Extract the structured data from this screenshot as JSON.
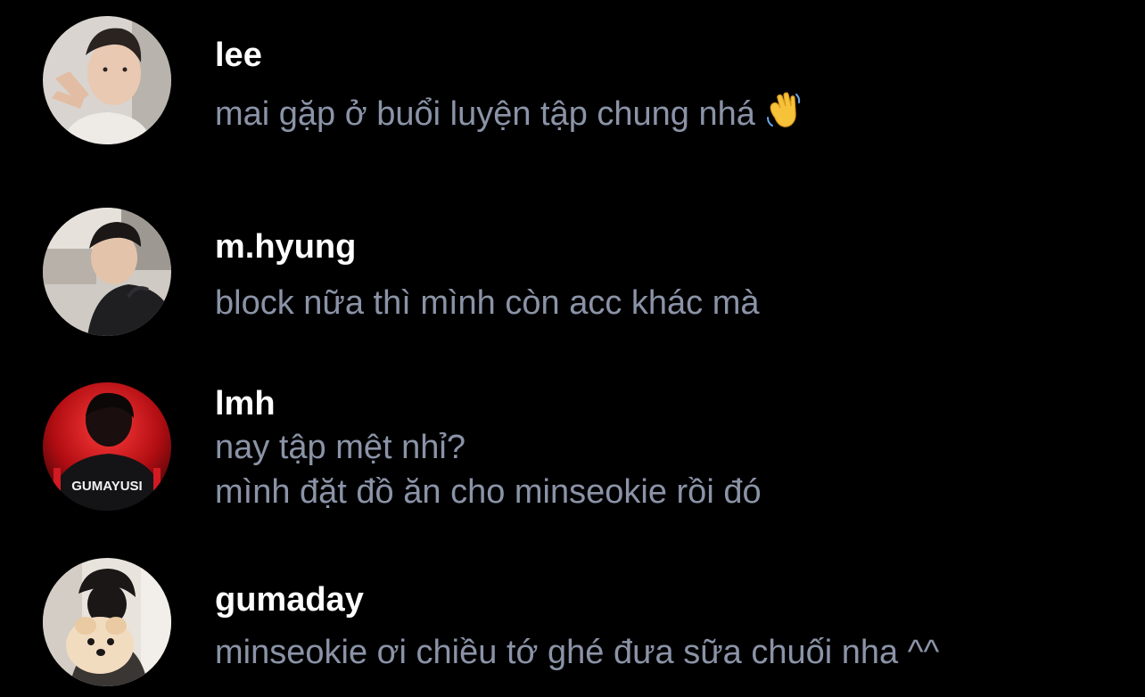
{
  "threads": [
    {
      "username": "lee",
      "lines": [
        "mai gặp ở buổi luyện tập chung nhá"
      ],
      "emoji": "waving-hand-icon"
    },
    {
      "username": "m.hyung",
      "lines": [
        "block nữa thì mình còn acc khác mà"
      ]
    },
    {
      "username": "lmh",
      "lines": [
        "nay tập mệt nhỉ?",
        "mình đặt đồ ăn cho minseokie rồi đó"
      ],
      "jersey_text": "GUMAYUSI"
    },
    {
      "username": "gumaday",
      "lines": [
        "minseokie ơi chiều tớ ghé đưa sữa chuối nha ^^"
      ]
    }
  ],
  "colors": {
    "background": "#000000",
    "username": "#ffffff",
    "message": "#8b93a7"
  }
}
